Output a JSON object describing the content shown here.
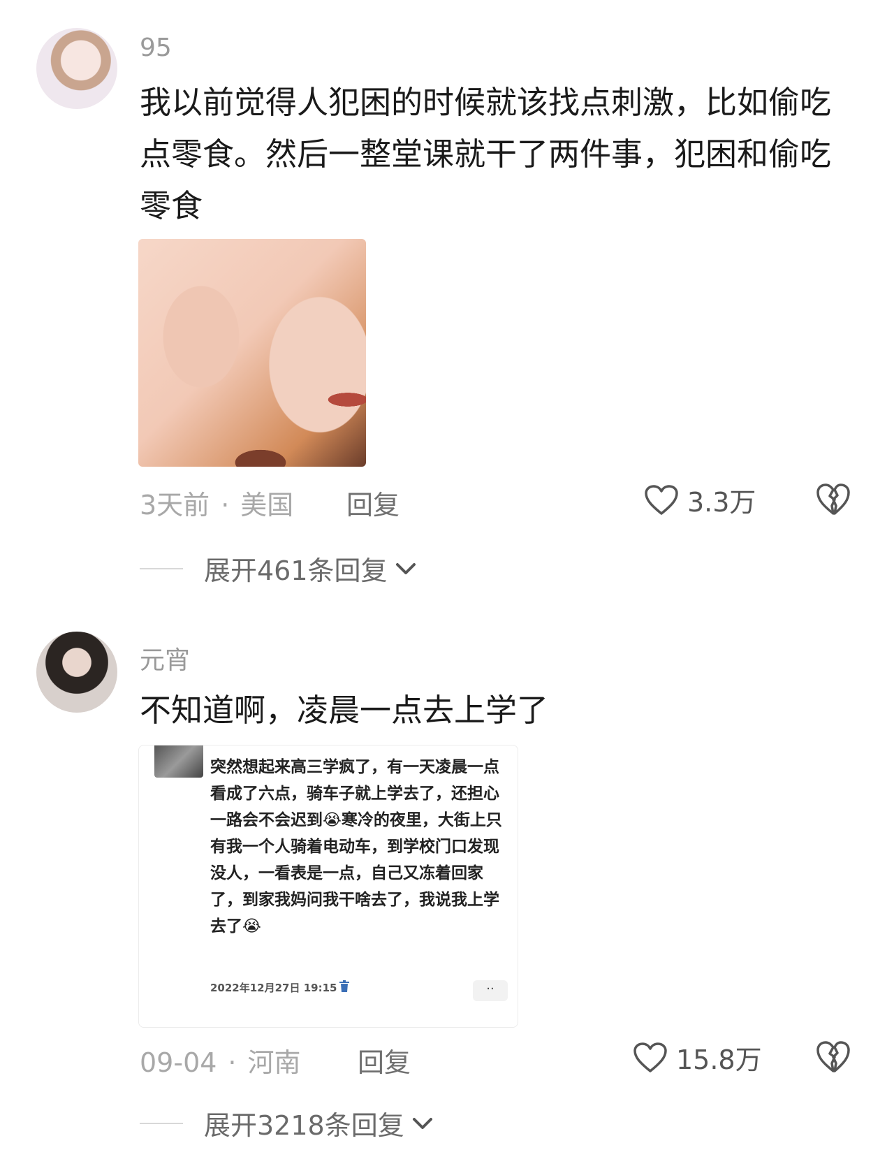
{
  "comments": [
    {
      "username": "95",
      "text": "我以前觉得人犯困的时候就该找点刺激，比如偷吃点零食。然后一整堂课就干了两件事，犯困和偷吃零食",
      "time": "3天前",
      "location": "美国",
      "dot": "·",
      "reply_label": "回复",
      "likes": "3.3万",
      "expand_label": "展开461条回复"
    },
    {
      "username": "元宵",
      "text": "不知道啊，凌晨一点去上学了",
      "embedded_text": "突然想起来高三学疯了，有一天凌晨一点看成了六点，骑车子就上学去了，还担心一路会不会迟到😭寒冷的夜里，大街上只有我一个人骑着电动车，到学校门口发现没人，一看表是一点，自己又冻着回家了，到家我妈问我干啥去了，我说我上学去了😭",
      "embedded_date": "2022年12月27日 19:15",
      "embedded_more": "··",
      "time": "09-04",
      "location": "河南",
      "dot": "·",
      "reply_label": "回复",
      "likes": "15.8万",
      "expand_label": "展开3218条回复"
    }
  ],
  "icons": {
    "like": "heart-outline-icon",
    "dislike": "broken-heart-icon",
    "expand": "chevron-down-icon",
    "delete": "trash-icon"
  }
}
